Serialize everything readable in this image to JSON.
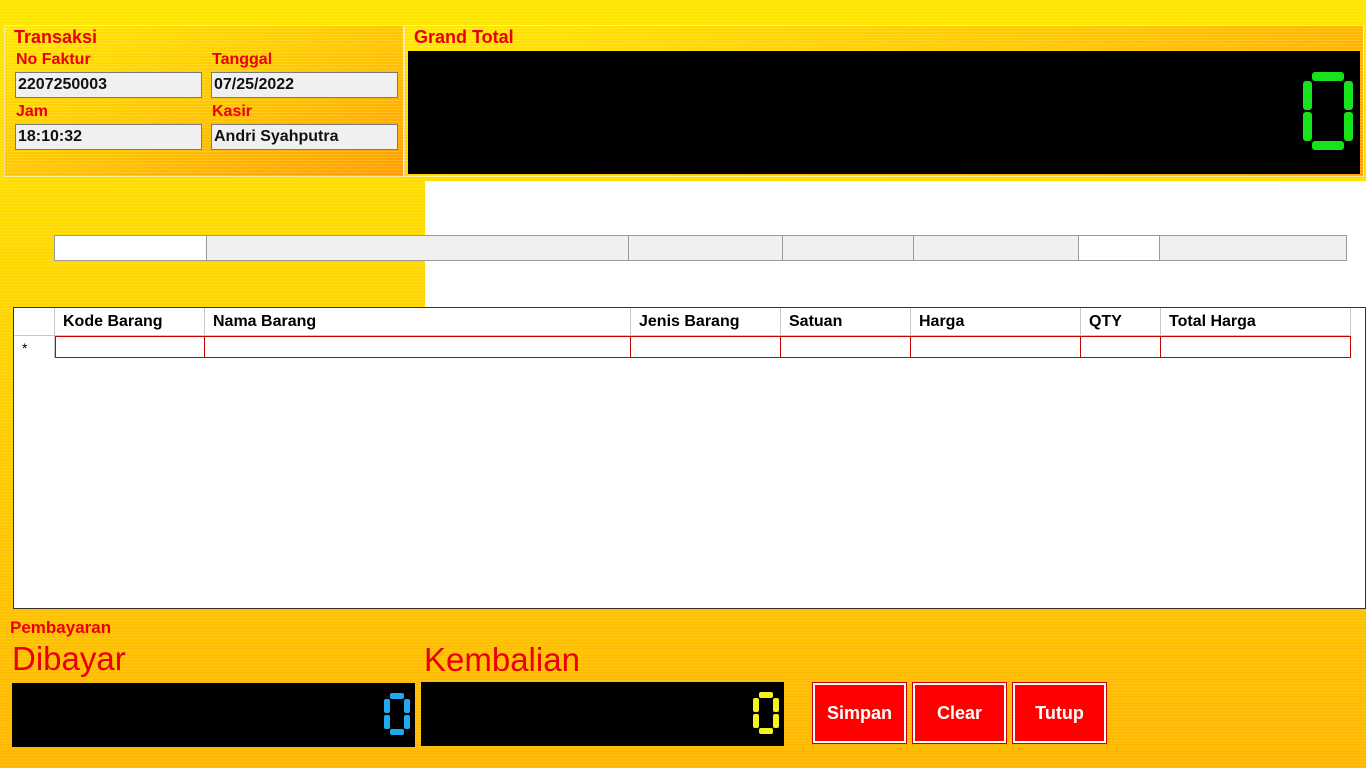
{
  "transaksi": {
    "title": "Transaksi",
    "no_faktur_label": "No Faktur",
    "no_faktur_value": "2207250003",
    "tanggal_label": "Tanggal",
    "tanggal_value": "07/25/2022",
    "jam_label": "Jam",
    "jam_value": "18:10:32",
    "kasir_label": "Kasir",
    "kasir_value": "Andri Syahputra"
  },
  "grand_total": {
    "title": "Grand Total",
    "value": "0",
    "digit_color": "#18e21c"
  },
  "grid": {
    "columns": [
      "Kode Barang",
      "Nama Barang",
      "Jenis Barang",
      "Satuan",
      "Harga",
      "QTY",
      "Total Harga"
    ],
    "new_row_marker": "*"
  },
  "pembayaran": {
    "title": "Pembayaran",
    "dibayar_label": "Dibayar",
    "dibayar_value": "0",
    "dibayar_color": "#21a9f0",
    "kembalian_label": "Kembalian",
    "kembalian_value": "0",
    "kembalian_color": "#f4f21a"
  },
  "buttons": {
    "simpan": "Simpan",
    "clear": "Clear",
    "tutup": "Tutup"
  },
  "colors": {
    "label_red": "#e8000b",
    "button_red": "#ff0000"
  }
}
